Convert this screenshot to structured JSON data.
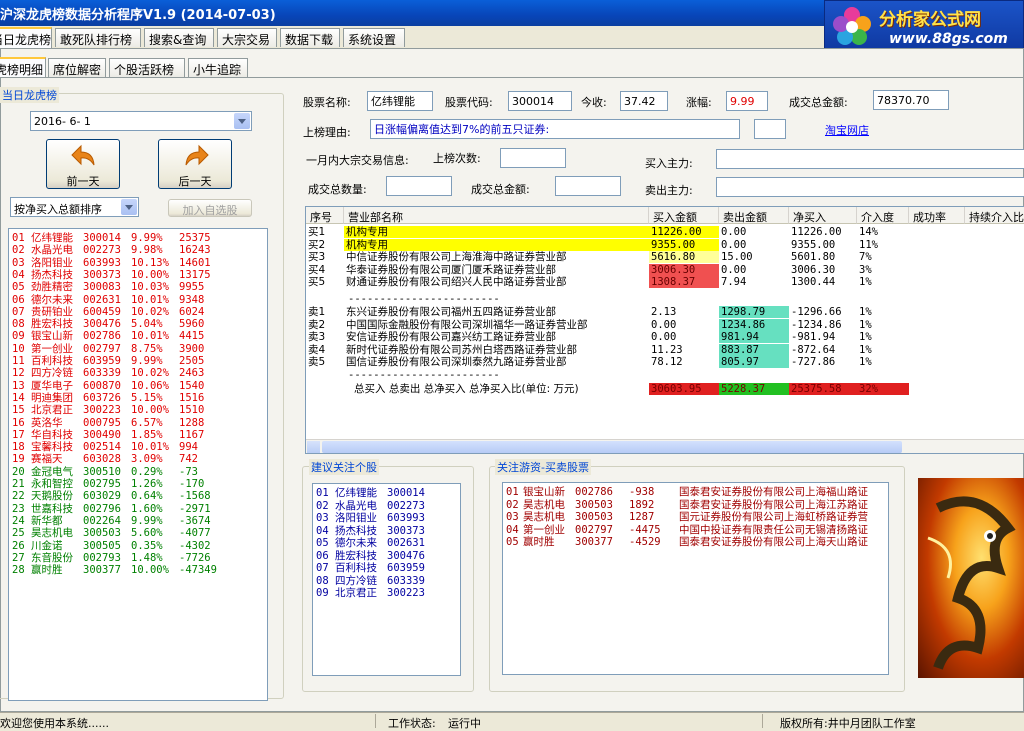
{
  "window": {
    "title": "沪深龙虎榜数据分析程序V1.9 (2014-07-03)"
  },
  "logo": {
    "brand": "分析家公式网",
    "url": "www.88gs.com"
  },
  "main_tabs": [
    "当日龙虎榜",
    "敢死队排行榜",
    "搜索&查询",
    "大宗交易",
    "数据下载",
    "系统设置"
  ],
  "sub_tabs": [
    "龙虎榜明细",
    "席位解密",
    "个股活跃榜",
    "小牛追踪"
  ],
  "left": {
    "group_title": "当日龙虎榜",
    "date": "2016- 6- 1",
    "prev_label": "前一天",
    "next_label": "后一天",
    "sort_option": "按净买入总额排序",
    "add_fav_label": "加入自选股",
    "stocks": [
      {
        "no": "01",
        "name": "亿纬锂能",
        "code": "300014",
        "pct": "9.99%",
        "net": "25375",
        "color": "red"
      },
      {
        "no": "02",
        "name": "水晶光电",
        "code": "002273",
        "pct": "9.98%",
        "net": "16243",
        "color": "red"
      },
      {
        "no": "03",
        "name": "洛阳钼业",
        "code": "603993",
        "pct": "10.13%",
        "net": "14601",
        "color": "red"
      },
      {
        "no": "04",
        "name": "扬杰科技",
        "code": "300373",
        "pct": "10.00%",
        "net": "13175",
        "color": "red"
      },
      {
        "no": "05",
        "name": "劲胜精密",
        "code": "300083",
        "pct": "10.03%",
        "net": "9955",
        "color": "red"
      },
      {
        "no": "06",
        "name": "德尔未来",
        "code": "002631",
        "pct": "10.01%",
        "net": "9348",
        "color": "red"
      },
      {
        "no": "07",
        "name": "贵研铂业",
        "code": "600459",
        "pct": "10.02%",
        "net": "6024",
        "color": "red"
      },
      {
        "no": "08",
        "name": "胜宏科技",
        "code": "300476",
        "pct": "5.04%",
        "net": "5960",
        "color": "red"
      },
      {
        "no": "09",
        "name": "银宝山新",
        "code": "002786",
        "pct": "10.01%",
        "net": "4415",
        "color": "red"
      },
      {
        "no": "10",
        "name": "第一创业",
        "code": "002797",
        "pct": "8.75%",
        "net": "3900",
        "color": "red"
      },
      {
        "no": "11",
        "name": "百利科技",
        "code": "603959",
        "pct": "9.99%",
        "net": "2505",
        "color": "red"
      },
      {
        "no": "12",
        "name": "四方冷链",
        "code": "603339",
        "pct": "10.02%",
        "net": "2463",
        "color": "red"
      },
      {
        "no": "13",
        "name": "厦华电子",
        "code": "600870",
        "pct": "10.06%",
        "net": "1540",
        "color": "red"
      },
      {
        "no": "14",
        "name": "明迪集团",
        "code": "603726",
        "pct": "5.15%",
        "net": "1516",
        "color": "red"
      },
      {
        "no": "15",
        "name": "北京君正",
        "code": "300223",
        "pct": "10.00%",
        "net": "1510",
        "color": "red"
      },
      {
        "no": "16",
        "name": "英洛华",
        "code": "000795",
        "pct": "6.57%",
        "net": "1288",
        "color": "red"
      },
      {
        "no": "17",
        "name": "华自科技",
        "code": "300490",
        "pct": "1.85%",
        "net": "1167",
        "color": "red"
      },
      {
        "no": "18",
        "name": "宝馨科技",
        "code": "002514",
        "pct": "10.01%",
        "net": "994",
        "color": "red"
      },
      {
        "no": "19",
        "name": "赛福天",
        "code": "603028",
        "pct": "3.09%",
        "net": "742",
        "color": "red"
      },
      {
        "no": "20",
        "name": "金冠电气",
        "code": "300510",
        "pct": "0.29%",
        "net": "-73",
        "color": "green"
      },
      {
        "no": "21",
        "name": "永和智控",
        "code": "002795",
        "pct": "1.26%",
        "net": "-170",
        "color": "green"
      },
      {
        "no": "22",
        "name": "天鹅股份",
        "code": "603029",
        "pct": "0.64%",
        "net": "-1568",
        "color": "green"
      },
      {
        "no": "23",
        "name": "世嘉科技",
        "code": "002796",
        "pct": "1.60%",
        "net": "-2971",
        "color": "green"
      },
      {
        "no": "24",
        "name": "新华都",
        "code": "002264",
        "pct": "9.99%",
        "net": "-3674",
        "color": "green"
      },
      {
        "no": "25",
        "name": "昊志机电",
        "code": "300503",
        "pct": "5.60%",
        "net": "-4077",
        "color": "green"
      },
      {
        "no": "26",
        "name": "川金诺",
        "code": "300505",
        "pct": "0.35%",
        "net": "-4302",
        "color": "green"
      },
      {
        "no": "27",
        "name": "东音股份",
        "code": "002793",
        "pct": "1.48%",
        "net": "-7726",
        "color": "green"
      },
      {
        "no": "28",
        "name": "赢时胜",
        "code": "300377",
        "pct": "10.00%",
        "net": "-47349",
        "color": "green"
      }
    ]
  },
  "info": {
    "name_label": "股票名称:",
    "name": "亿纬锂能",
    "code_label": "股票代码:",
    "code": "300014",
    "close_label": "今收:",
    "close": "37.42",
    "change_label": "涨幅:",
    "change": "9.99",
    "amount_label": "成交总金额:",
    "amount": "78370.70",
    "reason_label": "上榜理由:",
    "reason": "日涨幅偏离值达到7%的前五只证券:",
    "shop_link": "淘宝网店",
    "block_label": "一月内大宗交易信息:",
    "times_label": "上榜次数:",
    "buy_main_label": "买入主力:",
    "volume_label": "成交总数量:",
    "total_amount_label": "成交总金额:",
    "sell_main_label": "卖出主力:"
  },
  "grid": {
    "headers": [
      "序号",
      "营业部名称",
      "买入金额",
      "卖出金额",
      "净买入",
      "介入度",
      "成功率",
      "持续介入比"
    ],
    "buys": [
      {
        "no": "买1",
        "dept": "机构专用",
        "buy": "11226.00",
        "sell": "0.00",
        "net": "11226.00",
        "pct": "14%"
      },
      {
        "no": "买2",
        "dept": "机构专用",
        "buy": "9355.00",
        "sell": "0.00",
        "net": "9355.00",
        "pct": "11%"
      },
      {
        "no": "买3",
        "dept": "中信证券股份有限公司上海淮海中路证券营业部",
        "buy": "5616.80",
        "sell": "15.00",
        "net": "5601.80",
        "pct": "7%"
      },
      {
        "no": "买4",
        "dept": "华泰证券股份有限公司厦门厦禾路证券营业部",
        "buy": "3006.30",
        "sell": "0.00",
        "net": "3006.30",
        "pct": "3%"
      },
      {
        "no": "买5",
        "dept": "财通证券股份有限公司绍兴人民中路证券营业部",
        "buy": "1308.37",
        "sell": "7.94",
        "net": "1300.44",
        "pct": "1%"
      }
    ],
    "divider": "------------------------",
    "sells": [
      {
        "no": "卖1",
        "dept": "东兴证券股份有限公司福州五四路证券营业部",
        "buy": "2.13",
        "sell": "1298.79",
        "net": "-1296.66",
        "pct": "1%"
      },
      {
        "no": "卖2",
        "dept": "中国国际金融股份有限公司深圳福华一路证券营业部",
        "buy": "0.00",
        "sell": "1234.86",
        "net": "-1234.86",
        "pct": "1%"
      },
      {
        "no": "卖3",
        "dept": "安信证券股份有限公司嘉兴纺工路证券营业部",
        "buy": "0.00",
        "sell": "981.94",
        "net": "-981.94",
        "pct": "1%"
      },
      {
        "no": "卖4",
        "dept": "新时代证券股份有限公司苏州白塔西路证券营业部",
        "buy": "11.23",
        "sell": "883.87",
        "net": "-872.64",
        "pct": "1%"
      },
      {
        "no": "卖5",
        "dept": "国信证券股份有限公司深圳泰然九路证券营业部",
        "buy": "78.12",
        "sell": "805.97",
        "net": "-727.86",
        "pct": "1%"
      }
    ],
    "total_label": "总买入   总卖出   总净买入   总净买入比(单位: 万元)",
    "totals": {
      "buy": "30603.95",
      "sell": "5228.37",
      "net": "25375.58",
      "ratio": "32%"
    }
  },
  "suggest": {
    "title": "建议关注个股",
    "items": [
      {
        "no": "01",
        "name": "亿纬锂能",
        "code": "300014"
      },
      {
        "no": "02",
        "name": "水晶光电",
        "code": "002273"
      },
      {
        "no": "03",
        "name": "洛阳钼业",
        "code": "603993"
      },
      {
        "no": "04",
        "name": "扬杰科技",
        "code": "300373"
      },
      {
        "no": "05",
        "name": "德尔未来",
        "code": "002631"
      },
      {
        "no": "06",
        "name": "胜宏科技",
        "code": "300476"
      },
      {
        "no": "07",
        "name": "百利科技",
        "code": "603959"
      },
      {
        "no": "08",
        "name": "四方冷链",
        "code": "603339"
      },
      {
        "no": "09",
        "name": "北京君正",
        "code": "300223"
      }
    ]
  },
  "hot": {
    "title": "关注游资-买卖股票",
    "items": [
      {
        "no": "01",
        "name": "银宝山新",
        "code": "002786",
        "val": "-938",
        "dept": "国泰君安证券股份有限公司上海福山路证"
      },
      {
        "no": "02",
        "name": "昊志机电",
        "code": "300503",
        "val": "1892",
        "dept": "国泰君安证券股份有限公司上海江苏路证"
      },
      {
        "no": "03",
        "name": "昊志机电",
        "code": "300503",
        "val": "1287",
        "dept": "国元证券股份有限公司上海虹桥路证券营"
      },
      {
        "no": "04",
        "name": "第一创业",
        "code": "002797",
        "val": "-4475",
        "dept": "中国中投证券有限责任公司无锡清扬路证"
      },
      {
        "no": "05",
        "name": "赢时胜",
        "code": "300377",
        "val": "-4529",
        "dept": "国泰君安证券股份有限公司上海天山路证"
      }
    ]
  },
  "status": {
    "welcome": "欢迎您使用本系统......",
    "work_label": "工作状态:",
    "work_value": "运行中",
    "copyright": "版权所有:井中月团队工作室"
  }
}
